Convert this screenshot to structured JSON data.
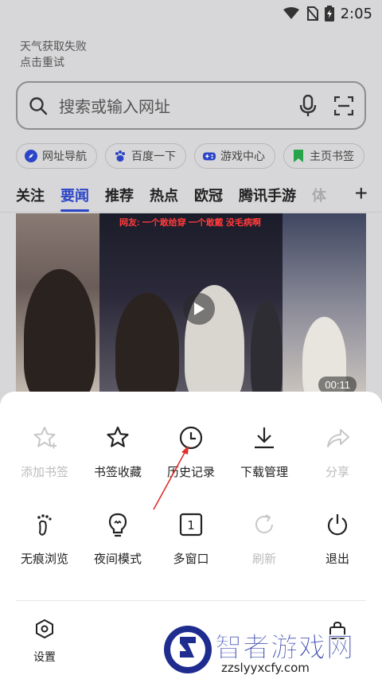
{
  "status_bar": {
    "time": "2:05"
  },
  "weather": {
    "line1": "天气获取失败",
    "line2": "点击重试"
  },
  "search": {
    "placeholder": "搜索或输入网址"
  },
  "quick_links": [
    {
      "label": "网址导航",
      "icon": "compass-icon",
      "color": "#2c45c8"
    },
    {
      "label": "百度一下",
      "icon": "paw-icon",
      "color": "#2c45c8"
    },
    {
      "label": "游戏中心",
      "icon": "gamepad-icon",
      "color": "#2c45c8"
    },
    {
      "label": "主页书签",
      "icon": "bookmark-icon",
      "color": "#27a34a"
    }
  ],
  "tabs": [
    "关注",
    "要闻",
    "推荐",
    "热点",
    "欧冠",
    "腾讯手游",
    "体"
  ],
  "active_tab": "要闻",
  "video": {
    "caption": "网友: 一个敢给穿 一个敢戴 没毛病啊",
    "duration": "00:11"
  },
  "menu": {
    "row1": [
      {
        "label": "添加书签",
        "icon": "star-plus-icon",
        "disabled": true
      },
      {
        "label": "书签收藏",
        "icon": "star-icon",
        "disabled": false
      },
      {
        "label": "历史记录",
        "icon": "clock-icon",
        "disabled": false
      },
      {
        "label": "下载管理",
        "icon": "download-icon",
        "disabled": false
      },
      {
        "label": "分享",
        "icon": "share-icon",
        "disabled": true
      }
    ],
    "row2": [
      {
        "label": "无痕浏览",
        "icon": "footprint-icon",
        "disabled": false
      },
      {
        "label": "夜间模式",
        "icon": "bulb-icon",
        "disabled": false
      },
      {
        "label": "多窗口",
        "icon": "window-count-icon",
        "disabled": false,
        "count": "1"
      },
      {
        "label": "刷新",
        "icon": "refresh-icon",
        "disabled": true
      },
      {
        "label": "退出",
        "icon": "power-icon",
        "disabled": false
      }
    ],
    "settings_label": "设置"
  },
  "watermark": {
    "title": "智者游戏网",
    "url": "zzslyyxcfy.com"
  },
  "colors": {
    "accent": "#2c45c8",
    "annotation": "#e0302a"
  }
}
